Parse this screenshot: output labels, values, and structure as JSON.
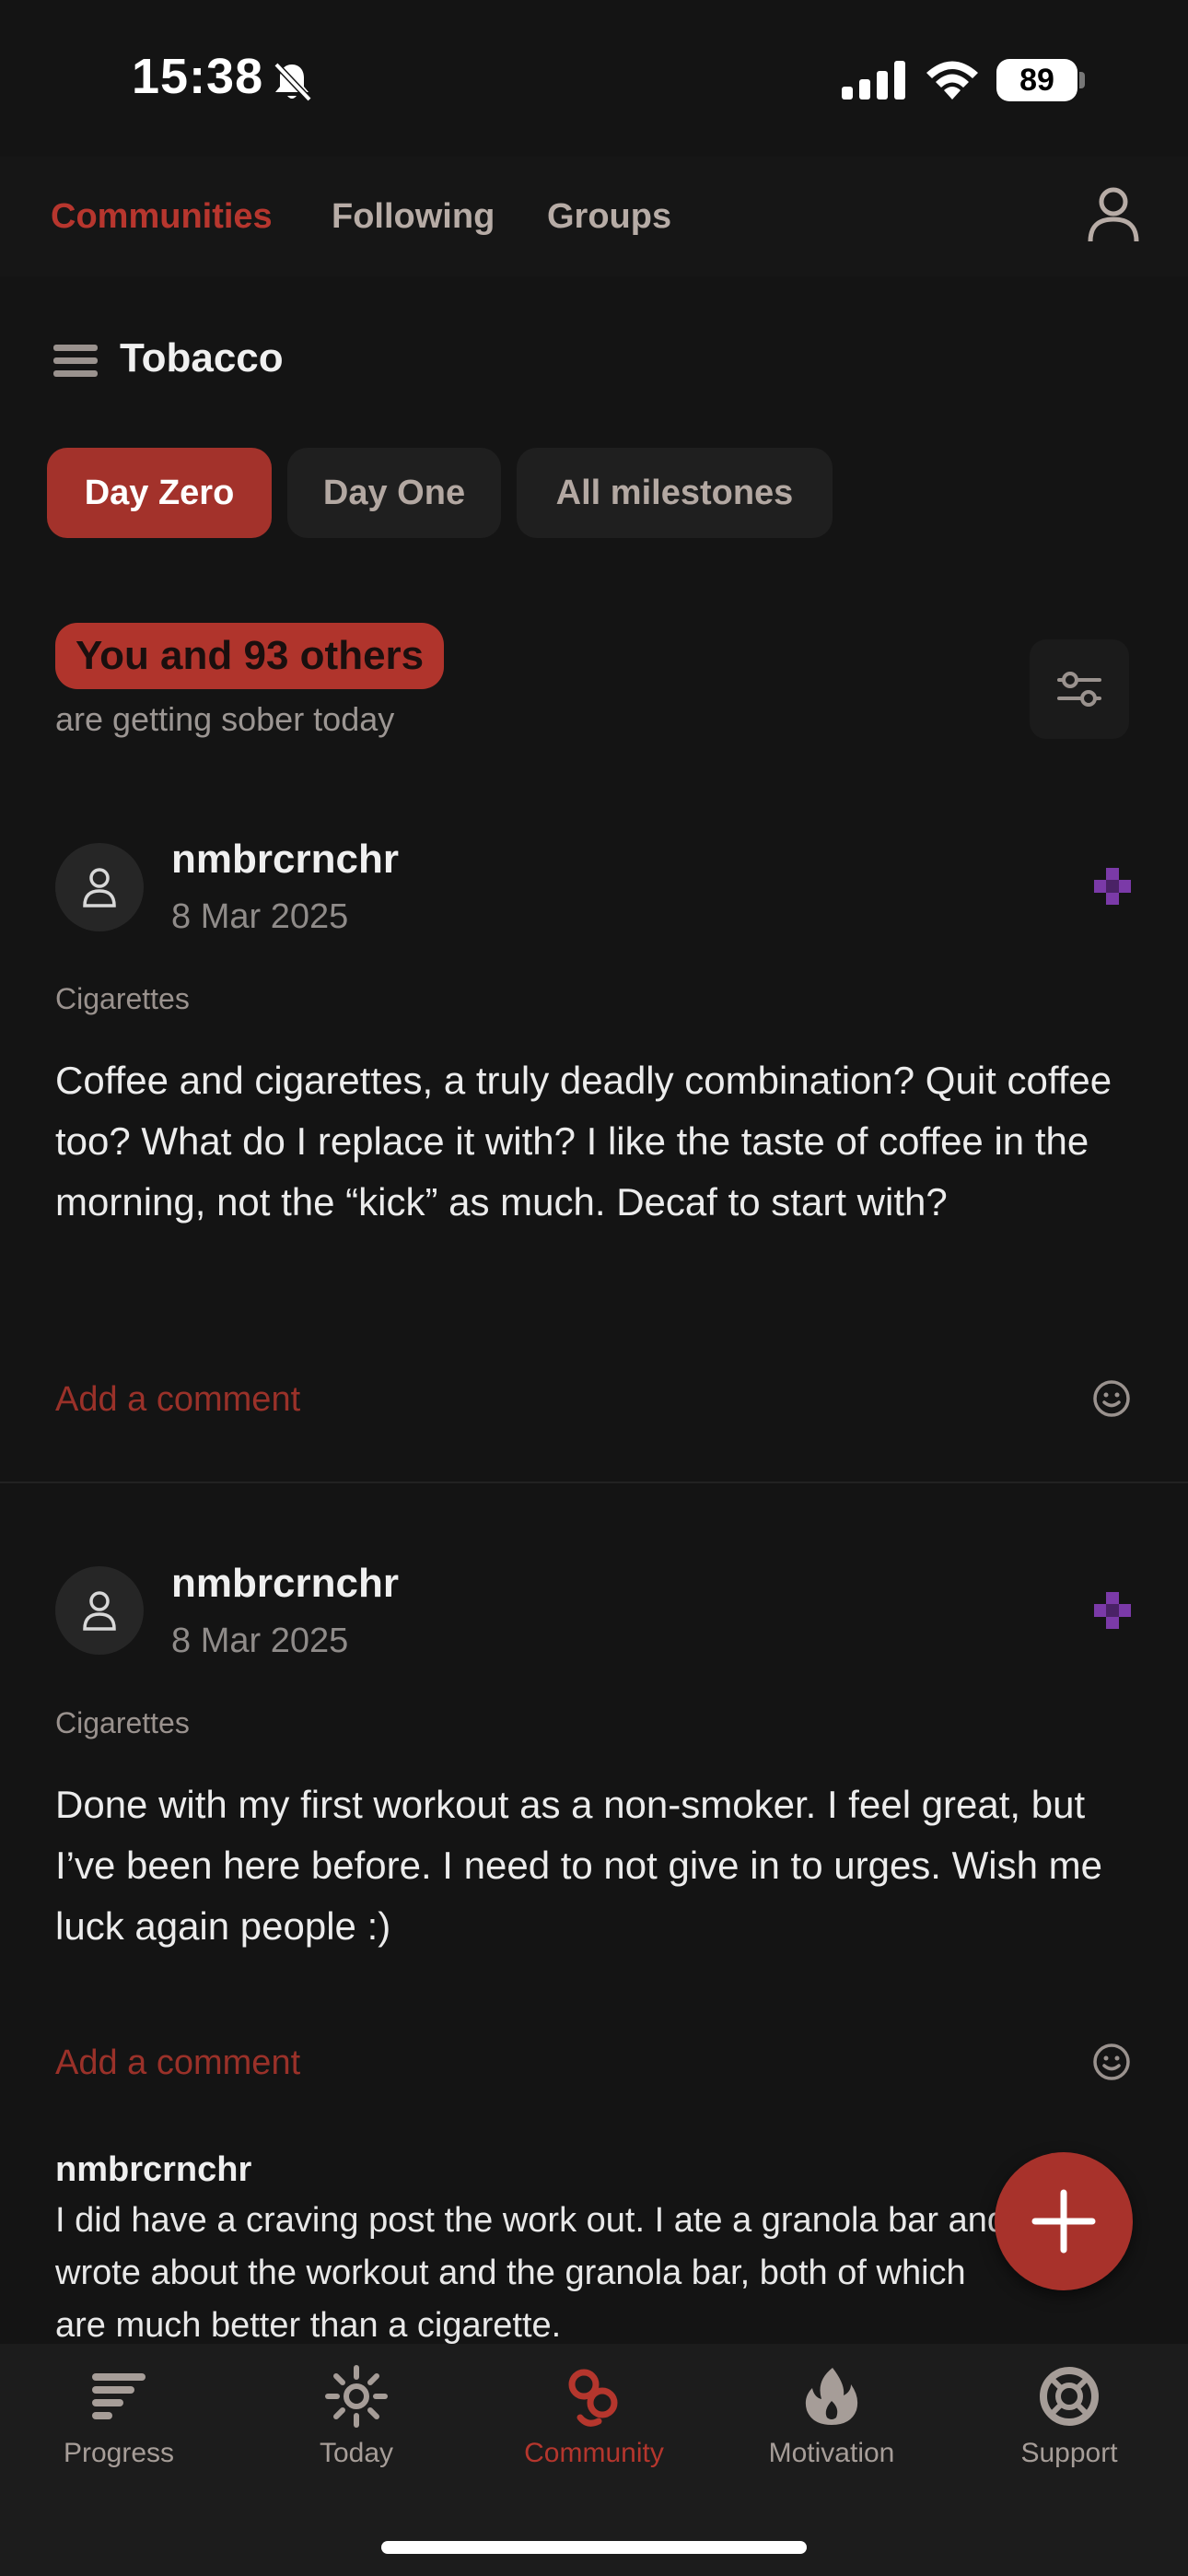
{
  "status": {
    "time": "15:38",
    "battery": "89"
  },
  "top_nav": {
    "tabs": [
      "Communities",
      "Following",
      "Groups"
    ]
  },
  "community": {
    "title": "Tobacco"
  },
  "milestones": [
    "Day Zero",
    "Day One",
    "All milestones"
  ],
  "summary": {
    "badge": "You and 93 others",
    "subtitle": "are getting sober today"
  },
  "posts": [
    {
      "user": "nmbrcrnchr",
      "date": "8 Mar 2025",
      "tag": "Cigarettes",
      "text": "Coffee and cigarettes, a truly deadly combination? Quit coffee too? What do I replace it with? I like the taste of coffee in the morning, not the “kick” as much. Decaf to start with?",
      "add_comment": "Add a comment"
    },
    {
      "user": "nmbrcrnchr",
      "date": "8 Mar 2025",
      "tag": "Cigarettes",
      "text": "Done with my first workout as a non-smoker. I feel great, but I’ve been here before. I need to not give in to urges. Wish me luck again people :)",
      "add_comment": "Add a comment",
      "comment": {
        "user": "nmbrcrnchr",
        "text": "I did have a craving post the work out. I ate a granola bar and wrote about the workout and the granola bar, both of which are much better than a cigarette."
      }
    }
  ],
  "bottom_nav": [
    {
      "label": "Progress",
      "icon": "progress-icon"
    },
    {
      "label": "Today",
      "icon": "sun-icon"
    },
    {
      "label": "Community",
      "icon": "community-icon"
    },
    {
      "label": "Motivation",
      "icon": "flame-icon"
    },
    {
      "label": "Support",
      "icon": "lifebuoy-icon"
    }
  ],
  "colors": {
    "accent": "#b0342c",
    "background": "#141414",
    "nav_background": "#1c1c1c",
    "badge_purple": "#7b3aa8"
  }
}
